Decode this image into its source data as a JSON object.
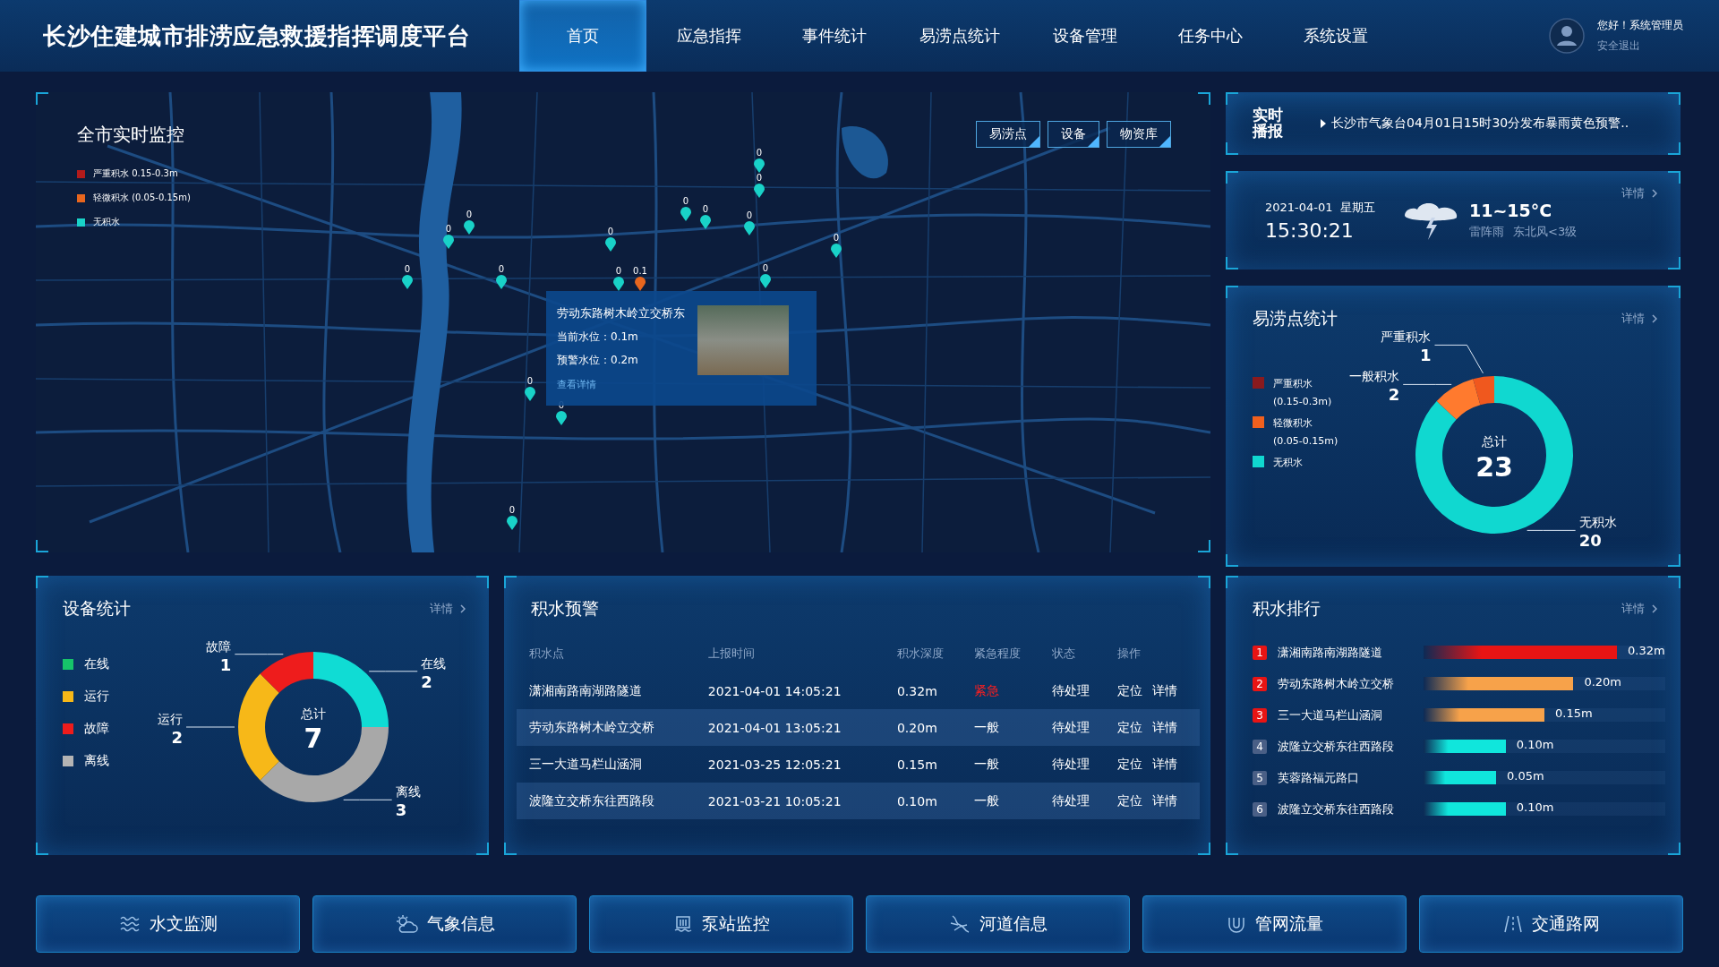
{
  "header": {
    "title": "长沙住建城市排涝应急救援指挥调度平台",
    "nav": [
      {
        "label": "首页",
        "selected": true
      },
      {
        "label": "应急指挥",
        "selected": false
      },
      {
        "label": "事件统计",
        "selected": false
      },
      {
        "label": "易涝点统计",
        "selected": false
      },
      {
        "label": "设备管理",
        "selected": false
      },
      {
        "label": "任务中心",
        "selected": false
      },
      {
        "label": "系统设置",
        "selected": false
      }
    ],
    "user": {
      "greeting": "您好！系统管理员",
      "logout": "安全退出"
    }
  },
  "map_panel": {
    "title": "全市实时监控",
    "legend": [
      {
        "label": "严重积水  0.15-0.3m",
        "color": "#b31b1b"
      },
      {
        "label": "轻微积水 (0.05-0.15m)",
        "color": "#e8661e"
      },
      {
        "label": "无积水",
        "color": "#19d2c8"
      }
    ],
    "filters": [
      {
        "label": "易涝点",
        "checked": true
      },
      {
        "label": "设备",
        "checked": true
      },
      {
        "label": "物资库",
        "checked": true
      }
    ],
    "markers": [
      {
        "label": "0",
        "color": "#19d2c8"
      },
      {
        "label": "0",
        "color": "#19d2c8"
      },
      {
        "label": "0",
        "color": "#19d2c8"
      },
      {
        "label": "0",
        "color": "#19d2c8"
      },
      {
        "label": "0",
        "color": "#19d2c8"
      },
      {
        "label": "0",
        "color": "#19d2c8"
      },
      {
        "label": "0",
        "color": "#19d2c8"
      },
      {
        "label": "0",
        "color": "#19d2c8"
      },
      {
        "label": "0",
        "color": "#19d2c8"
      },
      {
        "label": "0",
        "color": "#19d2c8"
      },
      {
        "label": "0",
        "color": "#19d2c8"
      },
      {
        "label": "0",
        "color": "#19d2c8"
      },
      {
        "label": "0.1",
        "color": "#e8661e"
      },
      {
        "label": "0",
        "color": "#19d2c8"
      },
      {
        "label": "0",
        "color": "#19d2c8"
      },
      {
        "label": "0",
        "color": "#19d2c8"
      },
      {
        "label": "0",
        "color": "#19d2c8"
      }
    ],
    "popup": {
      "title": "劳动东路树木岭立交桥东",
      "current": "当前水位：0.1m",
      "warning": "预警水位：0.2m",
      "link": "查看详情"
    }
  },
  "broadcast": {
    "label": "实时播报",
    "message": "长沙市气象台04月01日15时30分发布暴雨黄色预警.."
  },
  "weather": {
    "date": "2021-04-01  星期五",
    "time": "15:30:21",
    "temperature": "11~15°C",
    "condition": "雷阵雨",
    "wind": "东北风<3级",
    "details": "详情"
  },
  "flood_points": {
    "title": "易涝点统计",
    "details": "详情",
    "legend": [
      {
        "label": "严重积水",
        "range": "(0.15-0.3m)",
        "color": "#8a1a1e"
      },
      {
        "label": "轻微积水",
        "range": "(0.05-0.15m)",
        "color": "#f0601e"
      },
      {
        "label": "无积水",
        "color": "#10d8d0"
      }
    ],
    "total_label": "总计",
    "total": "23",
    "chart_data": {
      "type": "donut",
      "categories": [
        "无积水",
        "一般积水",
        "严重积水"
      ],
      "series": [
        {
          "values": [
            20,
            2,
            1
          ]
        }
      ],
      "colors": [
        "#10d8d0",
        "#ff7a2e",
        "#f0581e"
      ],
      "data_labels": true
    }
  },
  "devices": {
    "title": "设备统计",
    "details": "详情",
    "legend": [
      {
        "label": "在线",
        "color": "#16c46a"
      },
      {
        "label": "运行",
        "color": "#f7b818"
      },
      {
        "label": "故障",
        "color": "#ee1c1c"
      },
      {
        "label": "离线",
        "color": "#b4b4b4"
      }
    ],
    "total_label": "总计",
    "total": "7",
    "chart_data": {
      "type": "donut",
      "categories": [
        "在线",
        "离线",
        "运行",
        "故障"
      ],
      "series": [
        {
          "values": [
            2,
            3,
            2,
            1
          ]
        }
      ],
      "colors": [
        "#10dcd4",
        "#a8a8a8",
        "#f7b818",
        "#ee1c1c"
      ],
      "data_labels": true
    }
  },
  "warnings": {
    "title": "积水预警",
    "columns": [
      "积水点",
      "上报时间",
      "积水深度",
      "紧急程度",
      "状态",
      "操作"
    ],
    "rows": [
      {
        "point": "潇湘南路南湖路隧道",
        "time": "2021-04-01 14:05:21",
        "depth": "0.32m",
        "urgency": "紧急",
        "kind": "urgent",
        "status": "待处理",
        "actions": [
          "定位",
          "详情"
        ]
      },
      {
        "point": "劳动东路树木岭立交桥",
        "time": "2021-04-01 13:05:21",
        "depth": "0.20m",
        "urgency": "一般",
        "kind": "normal",
        "status": "待处理",
        "actions": [
          "定位",
          "详情"
        ]
      },
      {
        "point": "三一大道马栏山涵洞",
        "time": "2021-03-25 12:05:21",
        "depth": "0.15m",
        "urgency": "一般",
        "kind": "normal",
        "status": "待处理",
        "actions": [
          "定位",
          "详情"
        ]
      },
      {
        "point": "波隆立交桥东往西路段",
        "time": "2021-03-21 10:05:21",
        "depth": "0.10m",
        "urgency": "一般",
        "kind": "normal",
        "status": "待处理",
        "actions": [
          "定位",
          "详情"
        ]
      }
    ]
  },
  "ranking": {
    "title": "积水排行",
    "details": "详情",
    "items": [
      {
        "rank": "1",
        "name": "潇湘南路南湖路隧道",
        "value": "0.32m",
        "level": 0.8,
        "color": "#e81414"
      },
      {
        "rank": "2",
        "name": "劳动东路树木岭立交桥",
        "value": "0.20m",
        "level": 0.62,
        "color": "#f7a24a"
      },
      {
        "rank": "3",
        "name": "三一大道马栏山涵洞",
        "value": "0.15m",
        "level": 0.5,
        "color": "#f7a24a"
      },
      {
        "rank": "4",
        "name": "波隆立交桥东往西路段",
        "value": "0.10m",
        "level": 0.34,
        "color": "#10e6dc"
      },
      {
        "rank": "5",
        "name": "芙蓉路福元路口",
        "value": "0.05m",
        "level": 0.3,
        "color": "#10e6dc"
      },
      {
        "rank": "6",
        "name": "波隆立交桥东往西路段",
        "value": "0.10m",
        "level": 0.34,
        "color": "#10e6dc"
      }
    ]
  },
  "bottom_nav": [
    {
      "label": "水文监测",
      "kind": "waves"
    },
    {
      "label": "气象信息",
      "kind": "weather"
    },
    {
      "label": "泵站监控",
      "kind": "pump"
    },
    {
      "label": "河道信息",
      "kind": "river"
    },
    {
      "label": "管网流量",
      "kind": "pipe"
    },
    {
      "label": "交通路网",
      "kind": "road"
    }
  ]
}
